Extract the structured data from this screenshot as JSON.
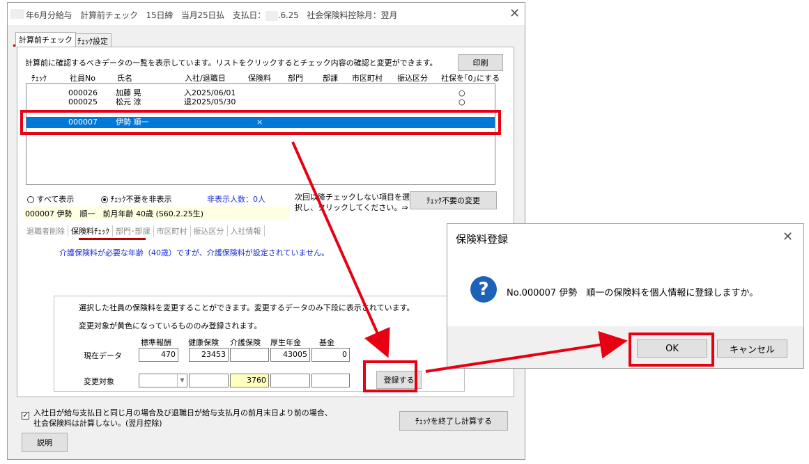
{
  "window": {
    "title_a": "年6月分給与　計算前チェック　15日締　当月25日払　支払日：",
    "title_b": ".6.25　社会保険料控除月：翌月",
    "tabs": [
      "計算前チェック",
      "ﾁｪｯｸ設定"
    ]
  },
  "main": {
    "description": "計算前に確認するべきデータの一覧を表示しています。リストをクリックするとチェック内容の確認と変更ができます。",
    "print_button": "印刷",
    "columns": [
      "ﾁｪｯｸ",
      "社員No",
      "氏名",
      "入社/退職日",
      "保険料",
      "部門",
      "部課",
      "市区町村",
      "振込区分",
      "社保を｢0｣にする"
    ],
    "rows": [
      {
        "no": "000026",
        "name": "加藤 晃",
        "date": "入2025/06/01",
        "hoken": "",
        "zero": "○"
      },
      {
        "no": "000025",
        "name": "松元 涼",
        "date": "退2025/05/30",
        "hoken": "",
        "zero": "○"
      },
      {
        "no": "000007",
        "name": "伊勢 順一",
        "date": "",
        "hoken": "×",
        "zero": ""
      }
    ],
    "filter_all": "すべて表示",
    "filter_hide": "ﾁｪｯｸ不要を非表示",
    "hidden_count": "非表示人数：0人",
    "next_note_1": "次回以降チェックしない項目を選",
    "next_note_2": "択し、クリックしてください。⇒",
    "change_unneeded_button": "ﾁｪｯｸ不要の変更",
    "employee_info": "000007 伊勢　順一　前月年齢 40歳 (S60.2.25生)",
    "subtabs": [
      "退職者削除",
      "保険料ﾁｪｯｸ",
      "部門･部課",
      "市区町村",
      "振込区分",
      "入社情報"
    ],
    "message": "介護保険料が必要な年齢（40歳）ですが、介護保険料が設定されていません。",
    "edit": {
      "note1": "選択した社員の保険料を変更することができます。変更するデータのみ下段に表示されています。",
      "note2": "変更対象が黄色になっているもののみ登録されます。",
      "headers": [
        "標準報酬",
        "健康保険",
        "介護保険",
        "厚生年金",
        "基金"
      ],
      "current_label": "現在データ",
      "current_values": [
        "470",
        "23453",
        "",
        "43005",
        "0"
      ],
      "target_label": "変更対象",
      "target_values": [
        "",
        "",
        "3760",
        "",
        ""
      ],
      "register_button": "登録する"
    },
    "footer_note_1": "入社日が給与支払日と同じ月の場合及び退職日が給与支払月の前月末日より前の場合、",
    "footer_note_2": "社会保険料は計算しない。(翌月控除)",
    "explain_button": "説明",
    "finish_button": "ﾁｪｯｸを終了し計算する"
  },
  "dialog": {
    "title": "保険料登録",
    "message": "No.000007 伊勢　順一の保険料を個人情報に登録しますか。",
    "ok": "OK",
    "cancel": "キャンセル"
  },
  "colors": {
    "accent_red": "#e60012",
    "selection_blue": "#0078d7",
    "highlight_yellow": "#ffffc0"
  }
}
